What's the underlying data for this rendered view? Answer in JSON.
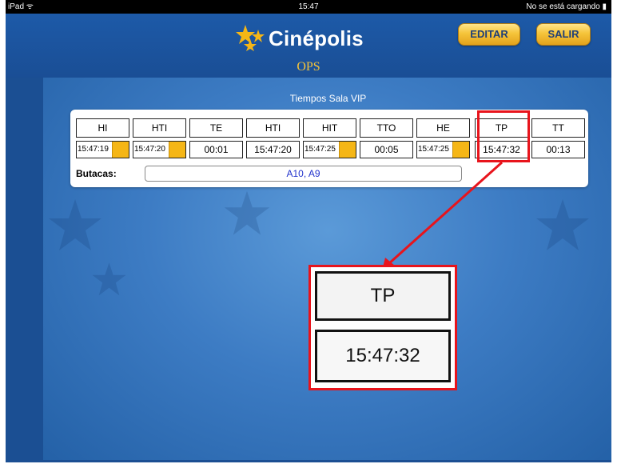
{
  "status_bar": {
    "device": "iPad",
    "time": "15:47",
    "charging": "No se está cargando"
  },
  "header": {
    "logo_text": "Cinépolis",
    "app_name": "OPS",
    "buttons": {
      "editar": "EDITAR",
      "salir": "SALIR"
    }
  },
  "section": {
    "title": "Tiempos Sala VIP"
  },
  "times": {
    "headers": [
      "HI",
      "HTI",
      "TE",
      "HTI",
      "HIT",
      "TTO",
      "HE",
      "TP",
      "TT"
    ],
    "values": [
      "15:47:19",
      "15:47:20",
      "00:01",
      "15:47:20",
      "15:47:25",
      "00:05",
      "15:47:25",
      "15:47:32",
      "00:13"
    ]
  },
  "butacas": {
    "label": "Butacas:",
    "value": "A10, A9"
  },
  "zoom": {
    "header": "TP",
    "value": "15:47:32"
  },
  "colors": {
    "accent_gold": "#f5c43a",
    "brand_blue": "#1b4f93",
    "highlight_red": "#e8141c"
  }
}
